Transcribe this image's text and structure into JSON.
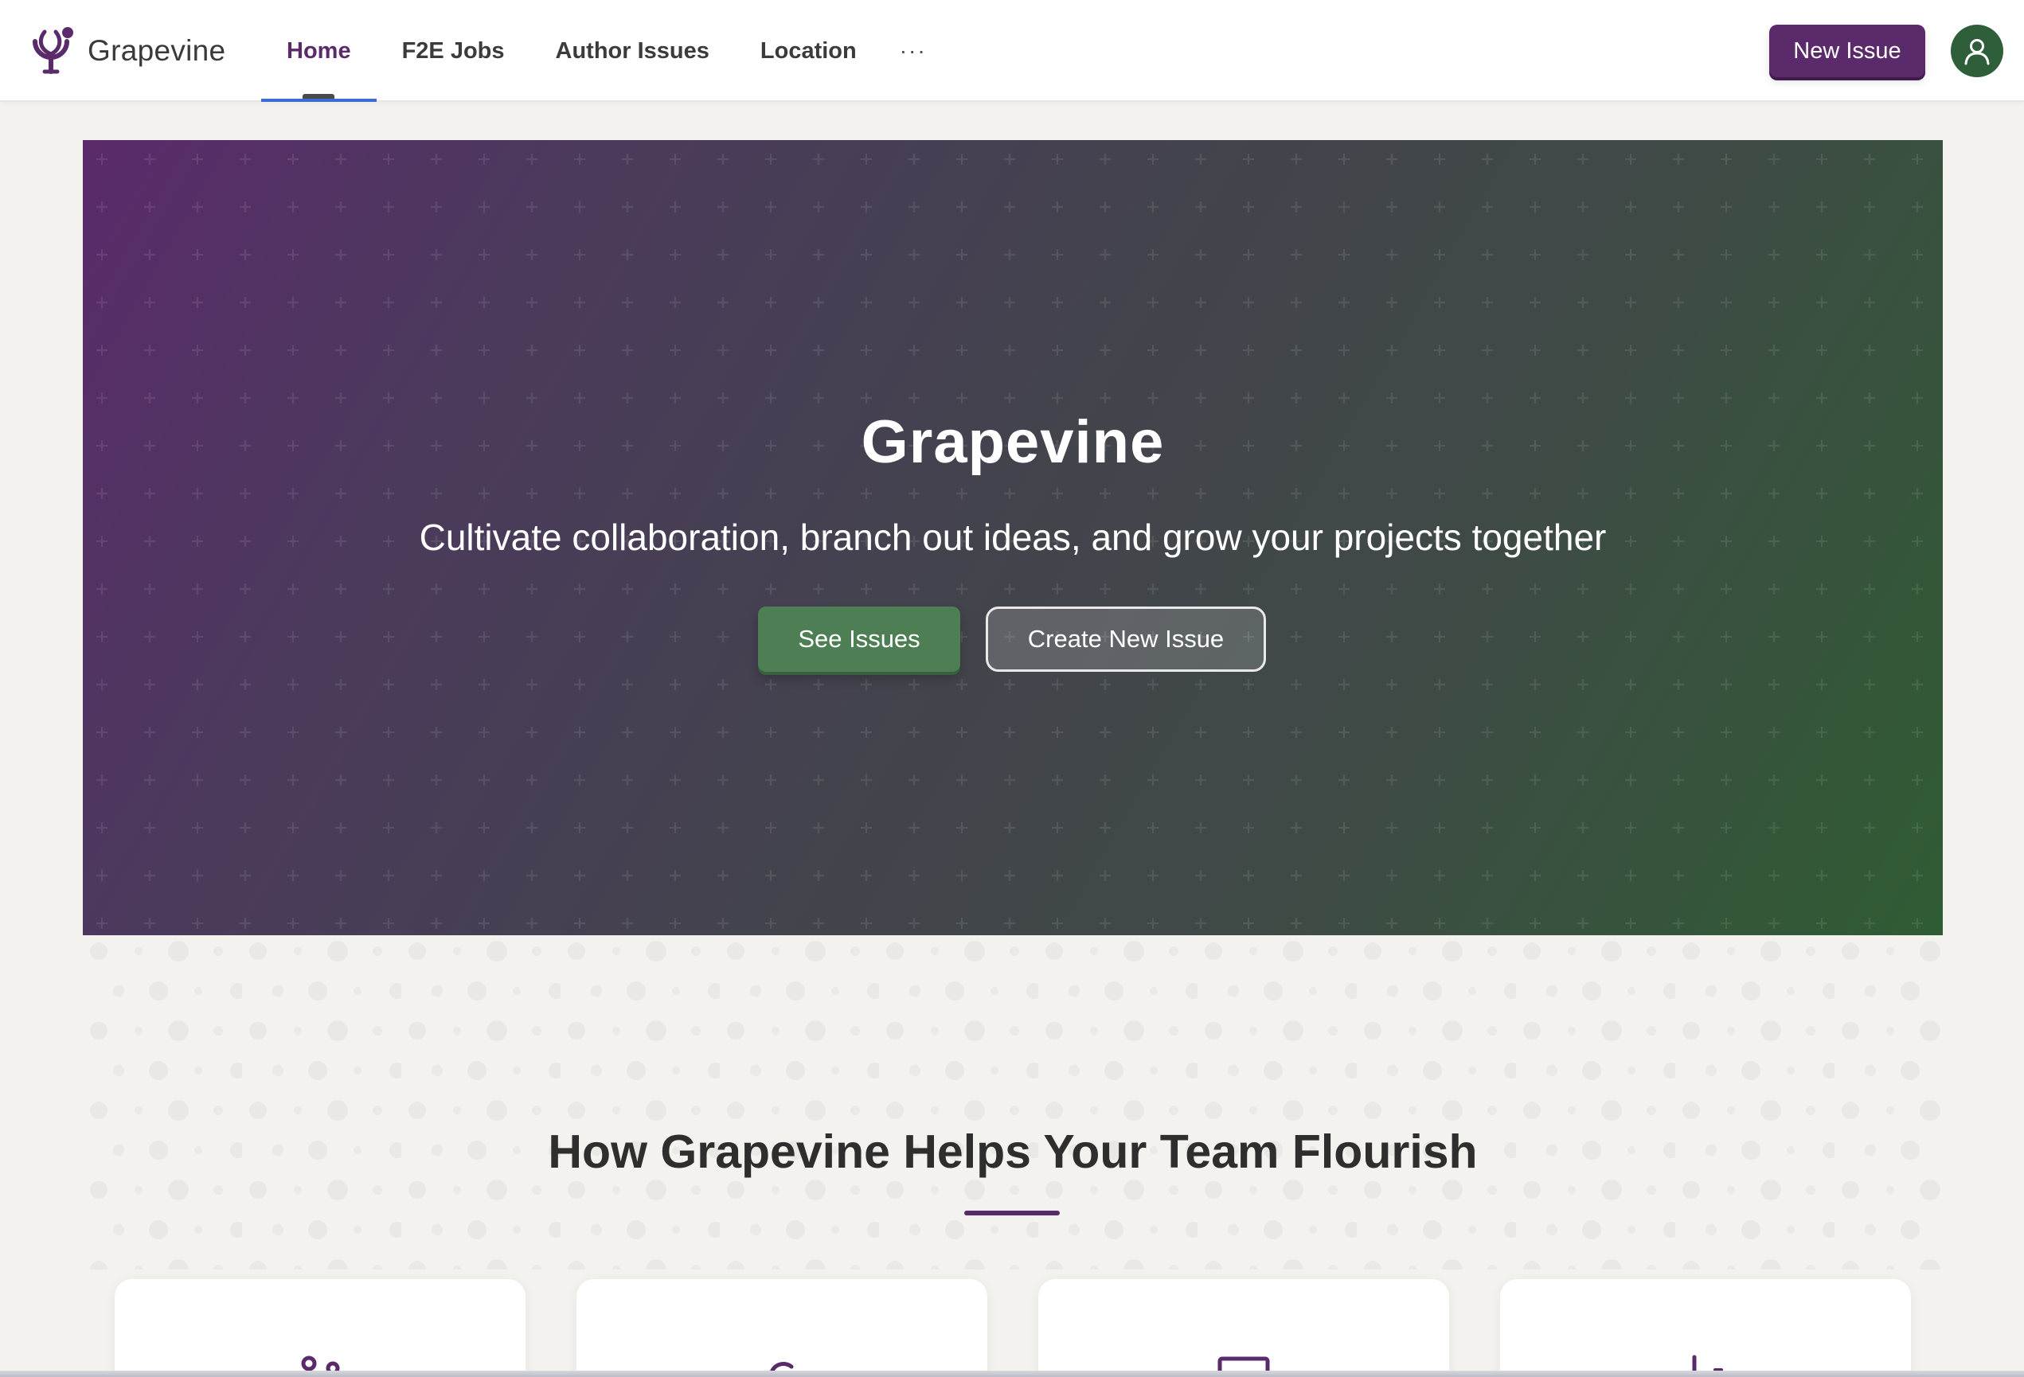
{
  "app": {
    "name": "Grapevine",
    "logo_icon": "grapevine-logo-icon"
  },
  "nav": {
    "tabs": [
      {
        "label": "Home",
        "active": true
      },
      {
        "label": "F2E Jobs",
        "active": false
      },
      {
        "label": "Author Issues",
        "active": false
      },
      {
        "label": "Location",
        "active": false
      }
    ],
    "more_label": "···",
    "new_issue_label": "New Issue",
    "avatar_icon": "user-icon"
  },
  "hero": {
    "title": "Grapevine",
    "subtitle": "Cultivate collaboration, branch out ideas, and grow your projects together",
    "primary_button": "See Issues",
    "secondary_button": "Create New Issue"
  },
  "features": {
    "title": "How Grapevine Helps Your Team Flourish",
    "cards": [
      {
        "icon": "people-icon"
      },
      {
        "icon": "refresh-icon"
      },
      {
        "icon": "chat-icon"
      },
      {
        "icon": "chart-icon"
      }
    ]
  },
  "colors": {
    "brand_purple": "#5a2a6b",
    "brand_green": "#4d7e54",
    "active_underline": "#3c6bd6",
    "page_bg": "#f4f2ee"
  }
}
